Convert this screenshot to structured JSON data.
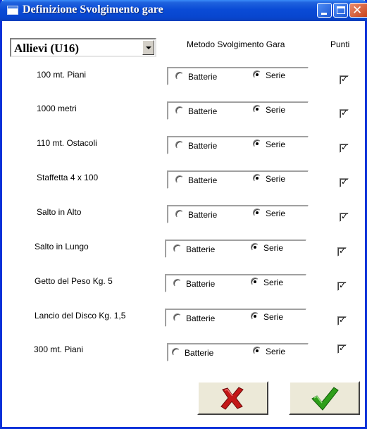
{
  "window": {
    "title": "Definizione Svolgimento gare",
    "titlebar_color": "#0a4bd6"
  },
  "category_select": {
    "selected": "Allievi (U16)"
  },
  "headers": {
    "metodo": "Metodo Svolgimento Gara",
    "punti": "Punti"
  },
  "radio_labels": {
    "batterie": "Batterie",
    "serie": "Serie"
  },
  "races": [
    {
      "name": "100 mt. Piani",
      "method": "Serie",
      "punti": true
    },
    {
      "name": "1000 metri",
      "method": "Serie",
      "punti": true
    },
    {
      "name": "110 mt. Ostacoli",
      "method": "Serie",
      "punti": true
    },
    {
      "name": "Staffetta 4 x 100",
      "method": "Serie",
      "punti": true
    },
    {
      "name": "Salto in Alto",
      "method": "Serie",
      "punti": true
    },
    {
      "name": "Salto in Lungo",
      "method": "Serie",
      "punti": true
    },
    {
      "name": "Getto del Peso Kg. 5",
      "method": "Serie",
      "punti": true
    },
    {
      "name": "Lancio del Disco Kg. 1,5",
      "method": "Serie",
      "punti": true
    },
    {
      "name": "300 mt. Piani",
      "method": "Serie",
      "punti": true
    }
  ],
  "buttons": {
    "cancel_icon": "red-x-icon",
    "ok_icon": "green-check-icon",
    "cancel_color": "#c41818",
    "ok_color": "#2e9e1a"
  }
}
